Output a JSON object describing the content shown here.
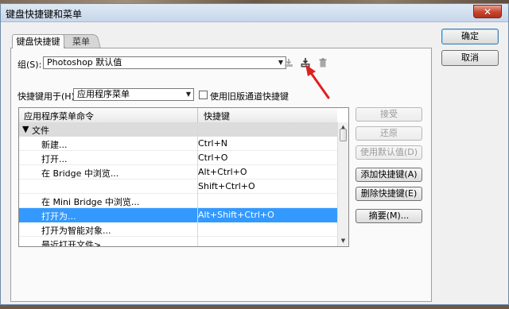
{
  "window": {
    "title": "键盘快捷键和菜单",
    "close_glyph": "✕"
  },
  "tabs": [
    {
      "label": "键盘快捷键",
      "active": true
    },
    {
      "label": "菜单",
      "active": false
    }
  ],
  "set_row": {
    "label": "组(S):",
    "value": "Photoshop 默认值",
    "icons": [
      "save-set-icon",
      "save-as-set-icon",
      "delete-set-icon"
    ]
  },
  "shortcuts_for": {
    "label": "快捷键用于(H):",
    "value": "应用程序菜单",
    "legacy_checkbox_label": "使用旧版通道快捷键",
    "legacy_checked": false
  },
  "table": {
    "headers": [
      "应用程序菜单命令",
      "快捷键"
    ],
    "rows": [
      {
        "command": "文件",
        "shortcut": "",
        "type": "section"
      },
      {
        "command": "新建...",
        "shortcut": "Ctrl+N",
        "type": "item"
      },
      {
        "command": "打开...",
        "shortcut": "Ctrl+O",
        "type": "item"
      },
      {
        "command": "在 Bridge 中浏览...",
        "shortcut": "Alt+Ctrl+O",
        "type": "item"
      },
      {
        "command": "",
        "shortcut": "Shift+Ctrl+O",
        "type": "item"
      },
      {
        "command": "在 Mini Bridge 中浏览...",
        "shortcut": "",
        "type": "item"
      },
      {
        "command": "打开为...",
        "shortcut": "Alt+Shift+Ctrl+O",
        "type": "selected"
      },
      {
        "command": "打开为智能对象...",
        "shortcut": "",
        "type": "item"
      },
      {
        "command": "最近打开文件>",
        "shortcut": "",
        "type": "item"
      }
    ]
  },
  "side_buttons": {
    "accept": "接受",
    "undo": "还原",
    "use_default": "使用默认值(D)",
    "add_shortcut": "添加快捷键(A)",
    "delete_shortcut": "删除快捷键(E)",
    "summarize": "摘要(M)..."
  },
  "dialog_buttons": {
    "ok": "确定",
    "cancel": "取消"
  },
  "colors": {
    "selection": "#3399ff",
    "annotation_arrow": "#e02020"
  }
}
